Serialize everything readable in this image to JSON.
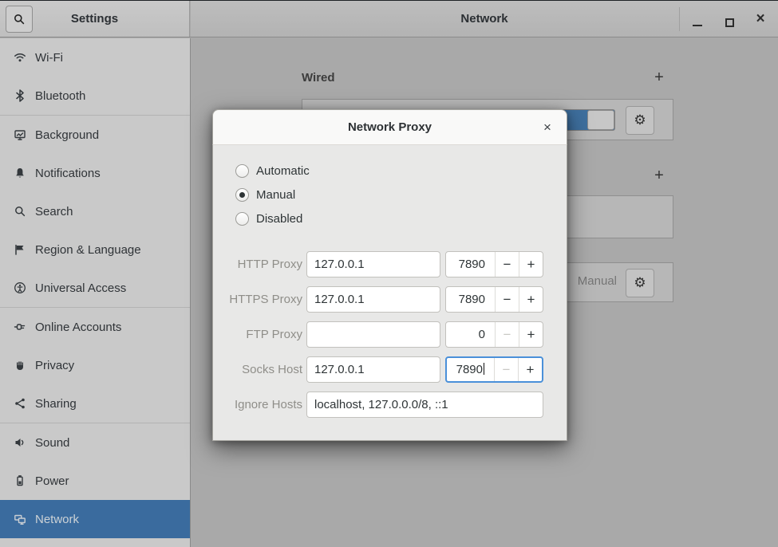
{
  "titlebar": {
    "app_title": "Settings",
    "panel_title": "Network",
    "close_glyph": "×"
  },
  "sidebar": {
    "items": [
      {
        "label": "Wi-Fi"
      },
      {
        "label": "Bluetooth"
      },
      {
        "label": "Background"
      },
      {
        "label": "Notifications"
      },
      {
        "label": "Search"
      },
      {
        "label": "Region & Language"
      },
      {
        "label": "Universal Access"
      },
      {
        "label": "Online Accounts"
      },
      {
        "label": "Privacy"
      },
      {
        "label": "Sharing"
      },
      {
        "label": "Sound"
      },
      {
        "label": "Power"
      },
      {
        "label": "Network",
        "selected": true
      }
    ]
  },
  "content": {
    "wired_section": {
      "title": "Wired",
      "add_button": "+"
    },
    "vpn_section": {
      "add_button": "+"
    },
    "proxy_row": {
      "value": "Manual"
    },
    "gear_glyph": "⚙"
  },
  "dialog": {
    "title": "Network Proxy",
    "close_glyph": "×",
    "modes": [
      {
        "label": "Automatic",
        "selected": false
      },
      {
        "label": "Manual",
        "selected": true
      },
      {
        "label": "Disabled",
        "selected": false
      }
    ],
    "rows": {
      "http": {
        "label": "HTTP Proxy",
        "host": "127.0.0.1",
        "port": "7890"
      },
      "https": {
        "label": "HTTPS Proxy",
        "host": "127.0.0.1",
        "port": "7890"
      },
      "ftp": {
        "label": "FTP Proxy",
        "host": "",
        "port": "0"
      },
      "socks": {
        "label": "Socks Host",
        "host": "127.0.0.1",
        "port": "7890"
      },
      "ignore": {
        "label": "Ignore Hosts",
        "value": "localhost, 127.0.0.0/8, ::1"
      }
    },
    "spinner": {
      "decrement": "−",
      "increment": "+"
    }
  },
  "colors": {
    "accent_focus": "#4a90d9",
    "selected_sidebar": "#3a6b9e",
    "dialog_header": "#f9f9f8",
    "dialog_body": "#e8e8e7",
    "backdrop_content": "#a9a9a9"
  }
}
